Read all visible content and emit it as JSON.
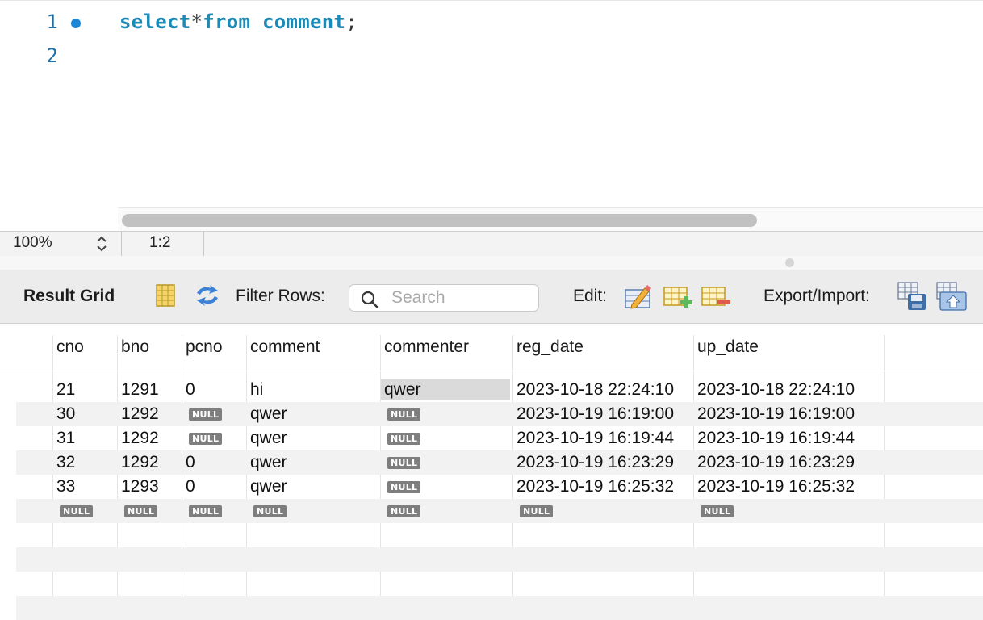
{
  "editor": {
    "lines": [
      {
        "num": "1",
        "keyword1": "select",
        "op": "*",
        "keyword2": "from",
        "table": "comment",
        "semicolon": ";"
      },
      {
        "num": "2"
      }
    ]
  },
  "statusbar": {
    "zoom": "100%",
    "stepper_icon": "⌃⌄",
    "cursor": "1:2"
  },
  "toolbar": {
    "title": "Result Grid",
    "filter_label": "Filter Rows:",
    "search_placeholder": "Search",
    "edit_label": "Edit:",
    "export_label": "Export/Import:"
  },
  "grid": {
    "columns": [
      "cno",
      "bno",
      "pcno",
      "comment",
      "commenter",
      "reg_date",
      "up_date"
    ],
    "null_label": "NULL",
    "rows": [
      [
        "21",
        "1291",
        "0",
        "hi",
        "qwer",
        "2023-10-18 22:24:10",
        "2023-10-18 22:24:10"
      ],
      [
        "30",
        "1292",
        null,
        "qwer",
        null,
        "2023-10-19 16:19:00",
        "2023-10-19 16:19:00"
      ],
      [
        "31",
        "1292",
        null,
        "qwer",
        null,
        "2023-10-19 16:19:44",
        "2023-10-19 16:19:44"
      ],
      [
        "32",
        "1292",
        "0",
        "qwer",
        null,
        "2023-10-19 16:23:29",
        "2023-10-19 16:23:29"
      ],
      [
        "33",
        "1293",
        "0",
        "qwer",
        null,
        "2023-10-19 16:25:32",
        "2023-10-19 16:25:32"
      ],
      [
        null,
        null,
        null,
        null,
        null,
        null,
        null
      ]
    ]
  },
  "colors": {
    "keyword": "#1a8ab8",
    "line_number": "#1f6fa8",
    "breakpoint_dot": "#1d86d4",
    "null_badge": "#7e7e7e"
  }
}
